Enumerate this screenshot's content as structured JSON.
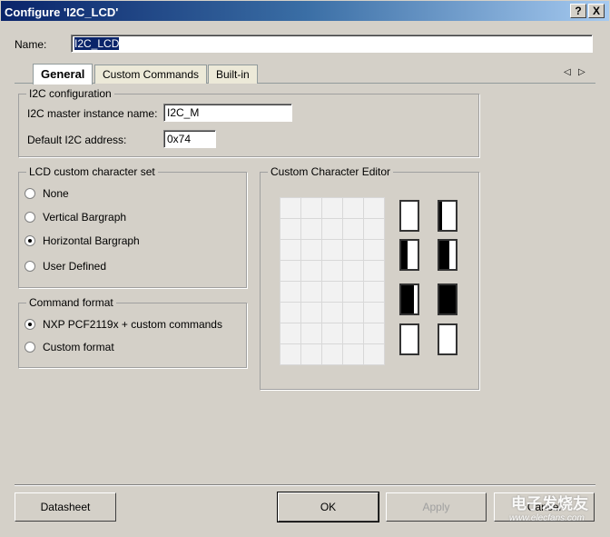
{
  "window": {
    "title": "Configure 'I2C_LCD'",
    "help": "?",
    "close": "X"
  },
  "name": {
    "label": "Name:",
    "value": "I2C_LCD"
  },
  "tabs": [
    {
      "label": "General",
      "active": true
    },
    {
      "label": "Custom Commands"
    },
    {
      "label": "Built-in"
    }
  ],
  "tab_scroll": {
    "left": "◁",
    "right": "▷"
  },
  "i2c": {
    "title": "I2C configuration",
    "master_label": "I2C master instance name:",
    "master_value": "I2C_M",
    "addr_label": "Default I2C address:",
    "addr_value": "0x74"
  },
  "charset": {
    "title": "LCD custom character set",
    "options": [
      "None",
      "Vertical Bargraph",
      "Horizontal Bargraph",
      "User Defined"
    ],
    "selected": "Horizontal Bargraph"
  },
  "command": {
    "title": "Command format",
    "options": [
      "NXP PCF2119x + custom commands",
      "Custom format"
    ],
    "selected": "NXP PCF2119x + custom commands"
  },
  "editor": {
    "title": "Custom Character Editor",
    "bar_fill_percent": [
      0,
      15,
      40,
      60,
      80,
      100,
      0,
      0
    ]
  },
  "buttons": {
    "datasheet": "Datasheet",
    "ok": "OK",
    "apply": "Apply",
    "cancel": "Cancel"
  },
  "watermark": {
    "text": "电子发烧友",
    "url": "www.elecfans.com"
  }
}
